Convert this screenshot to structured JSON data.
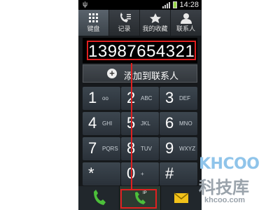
{
  "status_bar": {
    "time": "14:28",
    "usb_icon": "usb-icon",
    "signal_icon": "signal-bars-icon",
    "battery_icon": "battery-icon"
  },
  "tabs": [
    {
      "label": "键盘",
      "icon": "keypad-icon",
      "active": true
    },
    {
      "label": "记录",
      "icon": "call-log-icon",
      "active": false
    },
    {
      "label": "我的收藏",
      "icon": "star-icon",
      "active": false
    },
    {
      "label": "联系人",
      "icon": "person-icon",
      "active": false
    }
  ],
  "display": {
    "number": "13987654321"
  },
  "add_contact": {
    "label": "添加到联系人",
    "icon": "plus-circle-icon"
  },
  "keys": [
    {
      "digit": "1",
      "sub": "ᴏᴏ"
    },
    {
      "digit": "2",
      "sub": "ABC"
    },
    {
      "digit": "3",
      "sub": "DEF"
    },
    {
      "digit": "4",
      "sub": "GHI"
    },
    {
      "digit": "5",
      "sub": "JKL"
    },
    {
      "digit": "6",
      "sub": "MNO"
    },
    {
      "digit": "7",
      "sub": "PQRS"
    },
    {
      "digit": "8",
      "sub": "TUV"
    },
    {
      "digit": "9",
      "sub": "WXYZ"
    },
    {
      "digit": "*",
      "sub": ""
    },
    {
      "digit": "0",
      "sub": "+"
    },
    {
      "digit": "#",
      "sub": ""
    }
  ],
  "bottom_bar": {
    "call_icon": "phone-icon",
    "ip_call_icon": "ip-call-icon",
    "ip_label": "IP",
    "message_icon": "envelope-icon"
  },
  "watermark": {
    "logo": "KHCOO",
    "cn": "科技库",
    "url": "khcoo.com"
  },
  "colors": {
    "highlight": "#e02020",
    "call_green": "#4cbf3a",
    "message_yellow": "#f2c21a"
  }
}
